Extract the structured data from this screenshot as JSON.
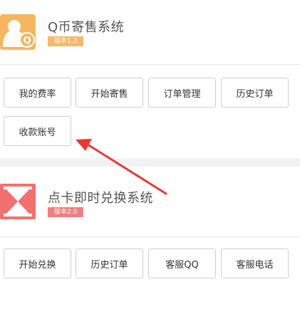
{
  "sections": [
    {
      "title": "Q币寄售系统",
      "version": "版本1.3",
      "badge_color": "#f4b969",
      "logo_color": "#f7b55f",
      "buttons": [
        "我的费率",
        "开始寄售",
        "订单管理",
        "历史订单",
        "收款账号"
      ]
    },
    {
      "title": "点卡即时兑换系统",
      "version": "版本2.0",
      "badge_color": "#f07e7e",
      "logo_color": "#f26f6f",
      "buttons": [
        "开始兑换",
        "历史订单",
        "客服QQ",
        "客服电话"
      ]
    }
  ],
  "annotation": {
    "arrow_color": "#e53935"
  }
}
